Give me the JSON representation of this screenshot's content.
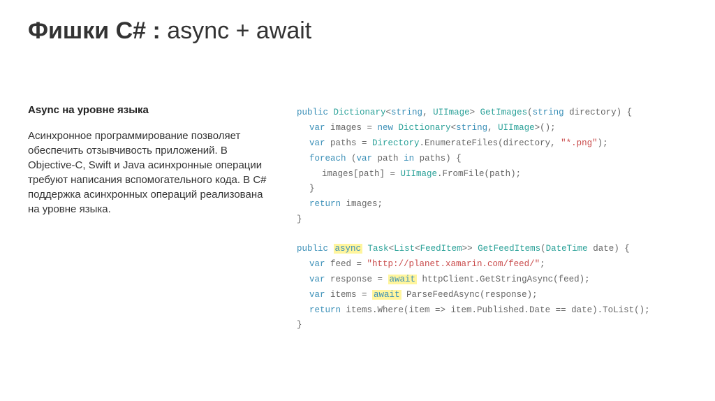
{
  "title": {
    "bold": "Фишки C# :",
    "rest": " async + await"
  },
  "left": {
    "subtitle": "Async на уровне языка",
    "body": "Асинхронное программирование позволяет обеспечить отзывчивость приложений. В Objective-C, Swift и Java асинхронные операции требуют написания вспомогательного кода. В C# поддержка асинхронных операций реализована на уровне языка."
  },
  "code": {
    "l1": {
      "t1": "public",
      "t2": " Dictionary",
      "t3": "<",
      "t4": "string",
      "t5": ", ",
      "t6": "UIImage",
      "t7": "> ",
      "t8": "GetImages",
      "t9": "(",
      "t10": "string",
      "t11": " directory) {"
    },
    "l2": {
      "t1": "var",
      "t2": " images = ",
      "t3": "new",
      "t4": " Dictionary",
      "t5": "<",
      "t6": "string",
      "t7": ", ",
      "t8": "UIImage",
      "t9": ">();"
    },
    "l3": {
      "t1": "var",
      "t2": " paths = ",
      "t3": "Directory",
      "t4": ".EnumerateFiles(directory, ",
      "t5": "\"*.png\"",
      "t6": ");"
    },
    "l4": {
      "t1": "foreach",
      "t2": " (",
      "t3": "var",
      "t4": " path ",
      "t5": "in",
      "t6": " paths) {"
    },
    "l5": {
      "t1": "images[path] = ",
      "t2": "UIImage",
      "t3": ".FromFile(path);"
    },
    "l6": {
      "t1": "}"
    },
    "l7": {
      "t1": "return",
      "t2": " images;"
    },
    "l8": {
      "t1": "}"
    },
    "l9": {
      "t1": "public",
      "t2": " ",
      "t3": "async",
      "t4": " Task",
      "t5": "<",
      "t6": "List",
      "t7": "<",
      "t8": "FeedItem",
      "t9": ">> ",
      "t10": "GetFeedItems",
      "t11": "(",
      "t12": "DateTime",
      "t13": " date) {"
    },
    "l10": {
      "t1": "var",
      "t2": " feed = ",
      "t3": "\"http://planet.xamarin.com/feed/\"",
      "t4": ";"
    },
    "l11": {
      "t1": "var",
      "t2": " response = ",
      "t3": "await",
      "t4": " httpClient.GetStringAsync(feed);"
    },
    "l12": {
      "t1": "var",
      "t2": " items = ",
      "t3": "await",
      "t4": " ParseFeedAsync(response);"
    },
    "l13": {
      "t1": "return",
      "t2": " items.Where(item => item.Published.Date == date).ToList();"
    },
    "l14": {
      "t1": "}"
    }
  }
}
